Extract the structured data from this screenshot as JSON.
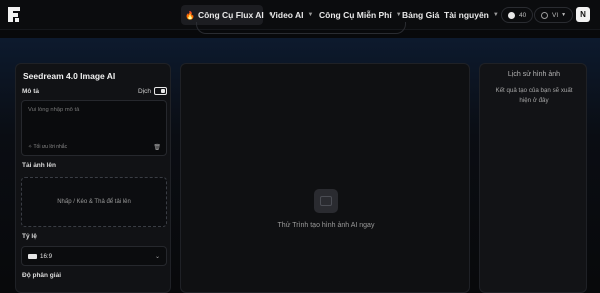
{
  "app": {
    "logo_letter": "F"
  },
  "nav": {
    "items": [
      {
        "label": "Công Cụ Flux AI",
        "active": true
      },
      {
        "label": "Video AI"
      },
      {
        "label": "Công Cụ Miễn Phí"
      },
      {
        "label": "Bảng Giá"
      },
      {
        "label": "Tài nguyên"
      }
    ]
  },
  "header": {
    "credits": "40",
    "language": "VI",
    "avatar_letter": "N"
  },
  "tool": {
    "title": "Seedream 4.0 Image AI",
    "prompt_label": "Mô tả",
    "translate_label": "Dịch",
    "prompt_placeholder": "Vui lòng nhập mô tả",
    "optimize_label": "Tối ưu lời nhắc",
    "upload_label": "Tải ảnh lên",
    "upload_hint": "Nhấp / Kéo & Thả để tải lên",
    "ratio_label": "Tỷ lệ",
    "ratio_value": "16:9",
    "resolution_label": "Độ phân giải"
  },
  "preview": {
    "empty_text": "Thử Trình tạo hình ảnh AI ngay"
  },
  "history": {
    "title": "Lịch sử hình ảnh",
    "empty_text": "Kết quả tạo của bạn sẽ xuất hiện ở đây"
  },
  "colors": {
    "accent": "#ff7a1a",
    "background": "#08090b"
  }
}
